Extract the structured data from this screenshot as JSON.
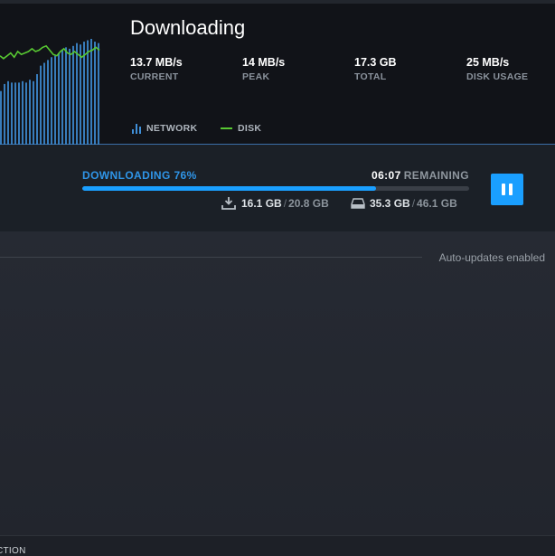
{
  "header": {
    "title": "Downloading",
    "stats": [
      {
        "value": "13.7 MB/s",
        "label": "CURRENT"
      },
      {
        "value": "14 MB/s",
        "label": "PEAK"
      },
      {
        "value": "17.3 GB",
        "label": "TOTAL"
      },
      {
        "value": "25 MB/s",
        "label": "DISK USAGE"
      }
    ],
    "legend": {
      "network": "NETWORK",
      "disk": "DISK"
    },
    "colors": {
      "network": "#3f8fd8",
      "disk": "#58c932"
    },
    "graph": {
      "network_levels": [
        0.38,
        0.43,
        0.45,
        0.44,
        0.44,
        0.44,
        0.45,
        0.44,
        0.46,
        0.45,
        0.5,
        0.56,
        0.58,
        0.6,
        0.62,
        0.63,
        0.65,
        0.67,
        0.69,
        0.68,
        0.7,
        0.72,
        0.71,
        0.73,
        0.74,
        0.75,
        0.73,
        0.72
      ],
      "disk_levels": [
        0.63,
        0.61,
        0.63,
        0.65,
        0.62,
        0.66,
        0.64,
        0.65,
        0.66,
        0.68,
        0.66,
        0.67,
        0.69,
        0.7,
        0.67,
        0.64,
        0.63,
        0.66,
        0.68,
        0.65,
        0.64,
        0.66,
        0.64,
        0.62,
        0.64,
        0.66,
        0.67,
        0.69,
        0.67
      ]
    }
  },
  "progress": {
    "status_label": "DOWNLOADING 76%",
    "percent": 76,
    "time": "06:07",
    "remaining_label": "REMAINING",
    "download": {
      "done": "16.1 GB",
      "sep": "/",
      "total": "20.8 GB"
    },
    "disk": {
      "done": "35.3 GB",
      "sep": "/",
      "total": "46.1 GB"
    },
    "pause_icon": "pause-icon"
  },
  "queue": {
    "auto_updates": "Auto-updates enabled"
  },
  "footer": {
    "label": "CTION"
  }
}
